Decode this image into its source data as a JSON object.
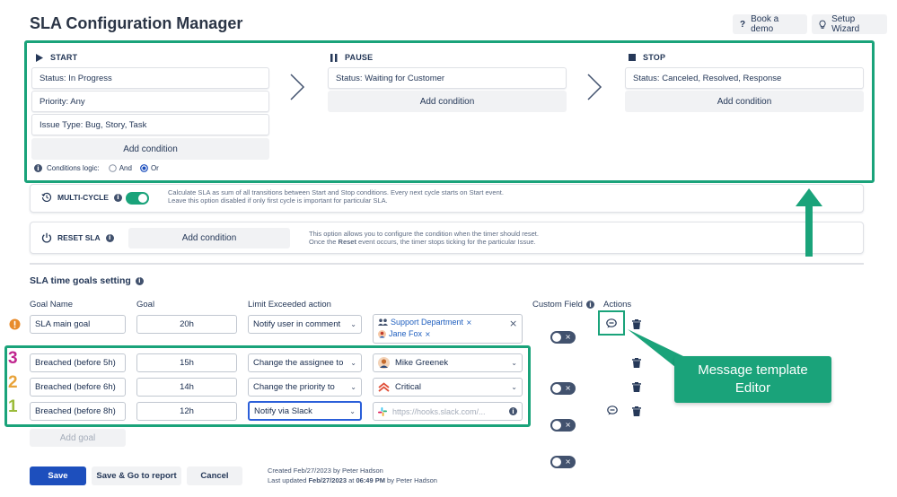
{
  "app": {
    "title": "SLA Configuration Manager"
  },
  "header": {
    "book_demo": "Book a demo",
    "setup_wizard": "Setup Wizard"
  },
  "start": {
    "label": "START",
    "conditions": [
      "Status: In Progress",
      "Priority: Any",
      "Issue Type: Bug, Story, Task"
    ],
    "add_condition": "Add condition",
    "logic_label": "Conditions logic:",
    "logic_and": "And",
    "logic_or": "Or"
  },
  "pause": {
    "label": "PAUSE",
    "conditions": [
      "Status: Waiting for Customer"
    ],
    "add_condition": "Add condition"
  },
  "stop": {
    "label": "STOP",
    "conditions": [
      "Status: Canceled, Resolved, Response"
    ],
    "add_condition": "Add condition"
  },
  "multicycle": {
    "label": "MULTI-CYCLE",
    "enabled": true,
    "desc_line1": "Calculate SLA as sum of all transitions between Start and Stop conditions. Every next cycle starts on Start event.",
    "desc_line2": "Leave this option disabled if only first cycle is important for particular SLA."
  },
  "reset": {
    "label": "RESET SLA",
    "add_condition": "Add condition",
    "desc_line1": "This option allows you to configure the condition when the timer should reset.",
    "desc_line2_pre": "Once the ",
    "desc_line2_bold": "Reset",
    "desc_line2_post": " event occurs, the timer stops ticking for the particular Issue."
  },
  "goals": {
    "section_title": "SLA time goals setting",
    "columns": {
      "goal_name": "Goal Name",
      "goal": "Goal",
      "limit_action": "Limit Exceeded action",
      "custom_field": "Custom Field",
      "actions": "Actions"
    },
    "main_goal": {
      "name": "SLA main goal",
      "goal": "20h",
      "action": "Notify user in comment",
      "tags": [
        "Support Department",
        "Jane Fox"
      ]
    },
    "rows": [
      {
        "number": "3",
        "number_color": "#c0268f",
        "name": "Breached (before 5h)",
        "goal": "15h",
        "action": "Change the assignee to",
        "target": "Mike Greenek"
      },
      {
        "number": "2",
        "number_color": "#e8a33a",
        "name": "Breached (before 6h)",
        "goal": "14h",
        "action": "Change the priority to",
        "target": "Critical"
      },
      {
        "number": "1",
        "number_color": "#9bbb3a",
        "name": "Breached (before 8h)",
        "goal": "12h",
        "action": "Notify via Slack",
        "target_placeholder": "https://hooks.slack.com/..."
      }
    ],
    "add_goal": "Add goal"
  },
  "footer": {
    "save": "Save",
    "save_go": "Save & Go to report",
    "cancel": "Cancel",
    "created": "Created Feb/27/2023 by Peter Hadson",
    "updated_pre": "Last updated ",
    "updated_bold": "Feb/27/2023",
    "updated_mid": " at ",
    "updated_bold2": "06:49 PM",
    "updated_post": " by Peter Hadson"
  },
  "callout": {
    "line1": "Message template",
    "line2": "Editor"
  },
  "colors": {
    "accent": "#1aa37a",
    "primary": "#1d4fbd"
  }
}
